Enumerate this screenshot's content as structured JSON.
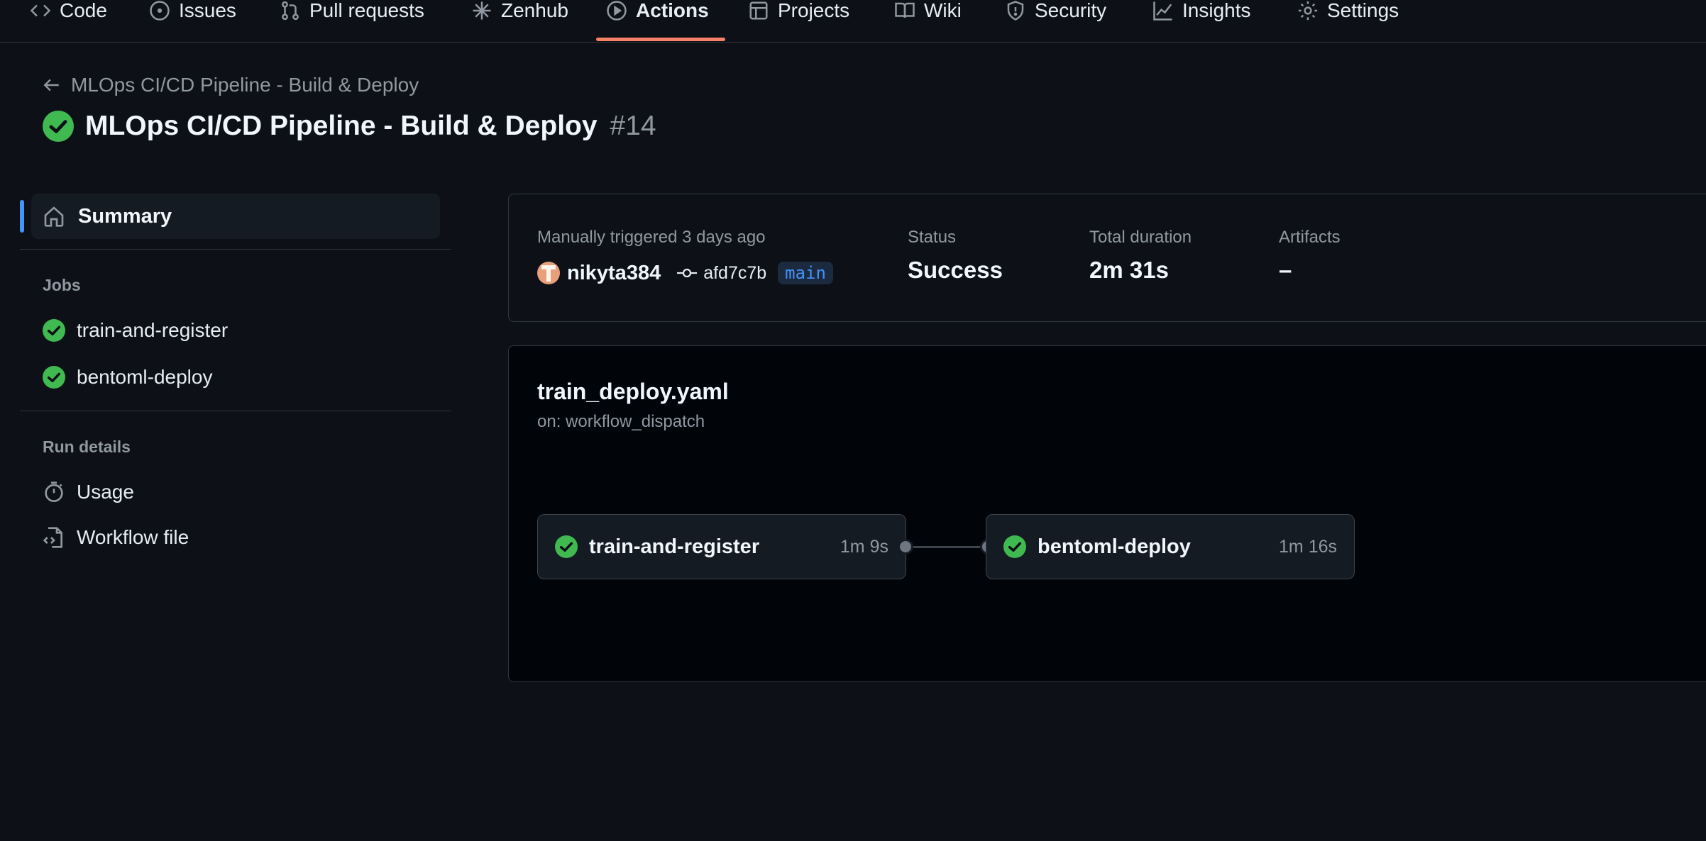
{
  "nav": {
    "items": [
      {
        "label": "Code",
        "icon": "code-icon"
      },
      {
        "label": "Issues",
        "icon": "issue-icon"
      },
      {
        "label": "Pull requests",
        "icon": "pull-request-icon"
      },
      {
        "label": "Zenhub",
        "icon": "zenhub-icon"
      },
      {
        "label": "Actions",
        "icon": "play-icon",
        "active": true
      },
      {
        "label": "Projects",
        "icon": "table-icon"
      },
      {
        "label": "Wiki",
        "icon": "book-icon"
      },
      {
        "label": "Security",
        "icon": "shield-icon"
      },
      {
        "label": "Insights",
        "icon": "graph-icon"
      },
      {
        "label": "Settings",
        "icon": "gear-icon"
      }
    ]
  },
  "header": {
    "back_label": "MLOps CI/CD Pipeline - Build & Deploy",
    "title": "MLOps CI/CD Pipeline - Build & Deploy",
    "run_number": "#14"
  },
  "sidebar": {
    "summary_label": "Summary",
    "jobs_heading": "Jobs",
    "jobs": [
      {
        "label": "train-and-register",
        "status": "success"
      },
      {
        "label": "bentoml-deploy",
        "status": "success"
      }
    ],
    "run_details_heading": "Run details",
    "usage_label": "Usage",
    "workflow_file_label": "Workflow file"
  },
  "summary": {
    "trigger_text": "Manually triggered 3 days ago",
    "actor": "nikyta384",
    "commit": "afd7c7b",
    "branch": "main",
    "status_label": "Status",
    "status_value": "Success",
    "duration_label": "Total duration",
    "duration_value": "2m 31s",
    "artifacts_label": "Artifacts",
    "artifacts_value": "–"
  },
  "workflow": {
    "file_name": "train_deploy.yaml",
    "trigger": "on: workflow_dispatch",
    "jobs": [
      {
        "name": "train-and-register",
        "duration": "1m 9s"
      },
      {
        "name": "bentoml-deploy",
        "duration": "1m 16s"
      }
    ]
  },
  "colors": {
    "success": "#3fb950",
    "accent": "#4493f8",
    "nav_underline": "#f78166",
    "background": "#0d1117"
  }
}
